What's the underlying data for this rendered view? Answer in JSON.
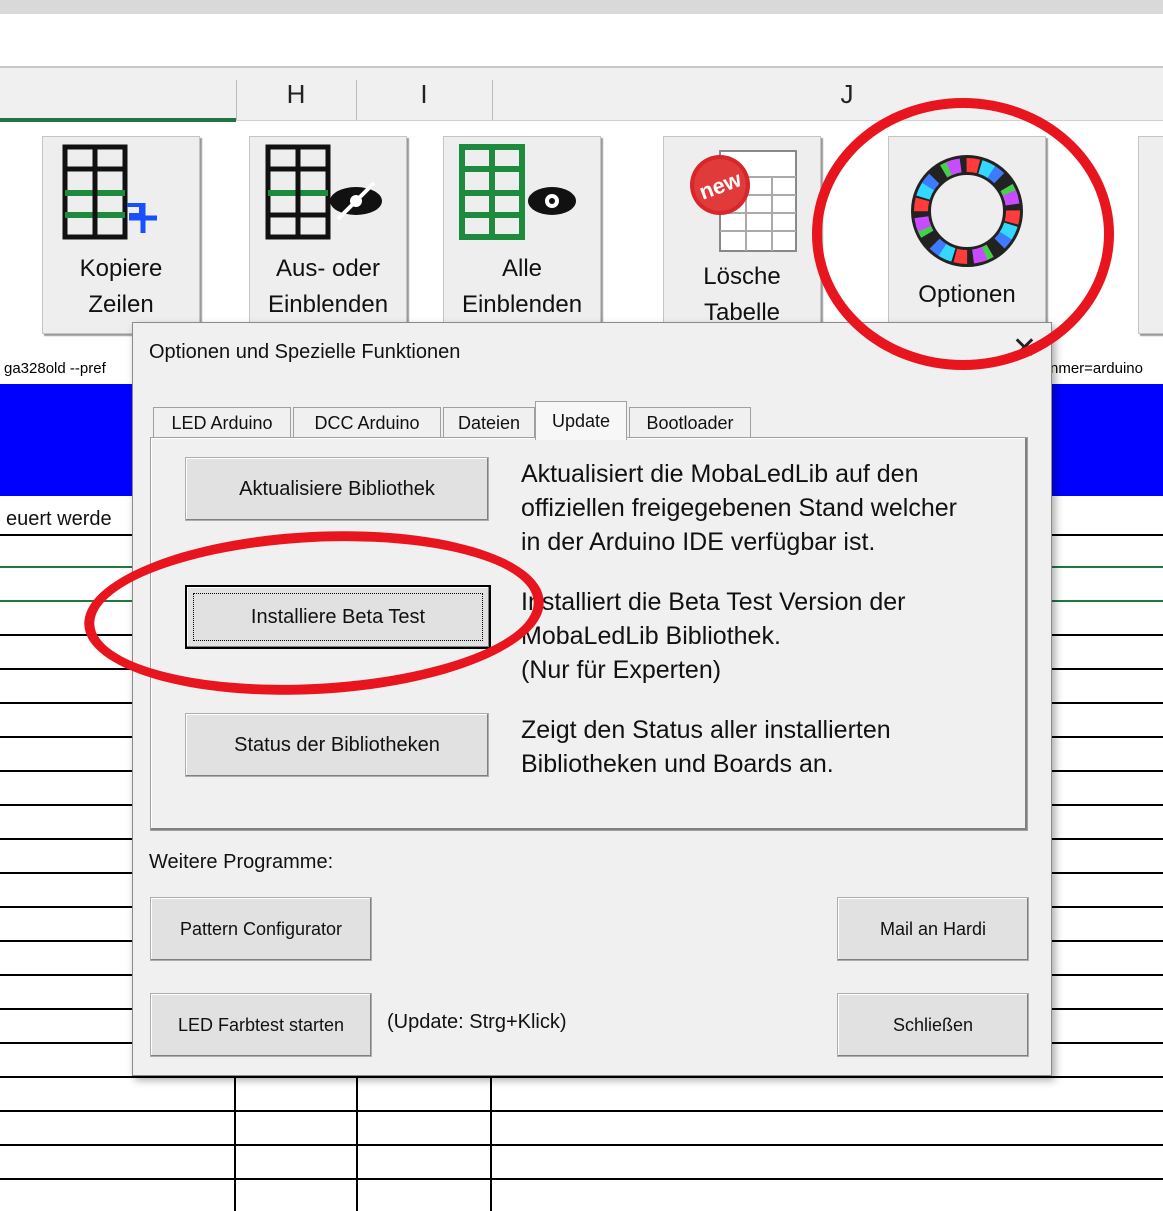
{
  "columns": [
    "H",
    "I",
    "J"
  ],
  "ribbon": [
    {
      "line1": "Kopiere",
      "line2": "Zeilen",
      "icon": "copy-rows-icon"
    },
    {
      "line1": "Aus- oder",
      "line2": "Einblenden",
      "icon": "hide-rows-icon"
    },
    {
      "line1": "Alle",
      "line2": "Einblenden",
      "icon": "show-all-icon"
    },
    {
      "line1": "Lösche",
      "line2": "Tabelle",
      "icon": "new-table-icon",
      "badge": "new"
    },
    {
      "line1": "Optionen",
      "line2": "",
      "icon": "led-ring-icon"
    }
  ],
  "sheet": {
    "cmd_left": "ga328old --pref",
    "cmd_right": "nmer=arduino",
    "cell_text": "euert werde"
  },
  "dialog": {
    "title": "Optionen und Spezielle Funktionen",
    "close": "✕",
    "tabs": [
      "LED Arduino",
      "DCC Arduino",
      "Dateien",
      "Update",
      "Bootloader"
    ],
    "active_tab": "Update",
    "actions": [
      {
        "button": "Aktualisiere Bibliothek",
        "lines": [
          "Aktualisiert die MobaLedLib auf den",
          "offiziellen freigegebenen Stand welcher",
          "in der Arduino IDE verfügbar ist."
        ]
      },
      {
        "button": "Installiere Beta Test",
        "lines": [
          "Installiert die Beta Test Version der",
          "MobaLedLib Bibliothek.",
          "(Nur für Experten)"
        ]
      },
      {
        "button": "Status der Bibliotheken",
        "lines": [
          "Zeigt den Status aller installierten",
          "Bibliotheken und Boards an."
        ]
      }
    ],
    "other_label": "Weitere Programme:",
    "pattern_button": "Pattern Configurator",
    "mail_button": "Mail an Hardi",
    "led_test_button": "LED Farbtest starten",
    "update_hint": "(Update: Strg+Klick)",
    "close_button": "Schließen"
  },
  "colors": {
    "annotation": "#e8141e",
    "band": "#0000ff",
    "excel_green": "#217346"
  }
}
